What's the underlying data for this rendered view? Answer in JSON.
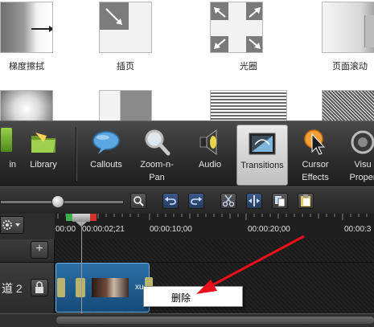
{
  "gallery": {
    "items": [
      {
        "label": "梯度擦拭"
      },
      {
        "label": "插页"
      },
      {
        "label": "光圈"
      },
      {
        "label": "页面滚动"
      }
    ]
  },
  "toolbar": {
    "buttons": [
      {
        "label": "in",
        "icon": "media-icon"
      },
      {
        "label": "Library",
        "icon": "folder-icon"
      },
      {
        "label": "Callouts",
        "icon": "speech-bubble-icon"
      },
      {
        "label": "Zoom-n-\nPan",
        "icon": "magnifier-icon"
      },
      {
        "label": "Audio",
        "icon": "speaker-icon"
      },
      {
        "label": "Transitions",
        "icon": "transitions-icon",
        "active": true
      },
      {
        "label": "Cursor\nEffects",
        "icon": "cursor-icon"
      },
      {
        "label": "Visu\nProper",
        "icon": "visual-properties-icon"
      }
    ]
  },
  "timeline": {
    "ruler_labels": [
      "00:00",
      "00:00:02;21",
      "00:00:10;00",
      "00:00:20;00",
      "00:00:3"
    ],
    "track2": {
      "name": "道 2"
    },
    "clip": {
      "label": "xu"
    }
  },
  "context_menu": {
    "delete_label": "删除"
  },
  "colors": {
    "playhead": "#9a9a9a",
    "clip": "#1e5a8a",
    "annotation_arrow": "#e8101a"
  }
}
